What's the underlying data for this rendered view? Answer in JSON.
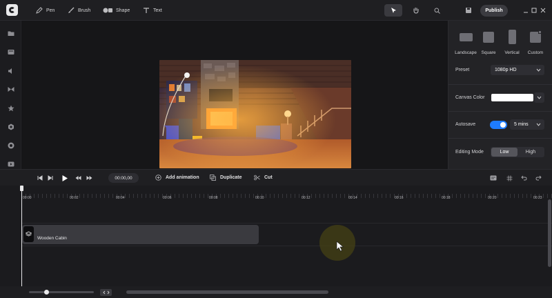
{
  "toolbar": {
    "tools": [
      {
        "label": "Pen",
        "icon": "pen-icon"
      },
      {
        "label": "Brush",
        "icon": "brush-icon"
      },
      {
        "label": "Shape",
        "icon": "shape-icon"
      },
      {
        "label": "Text",
        "icon": "text-icon"
      }
    ],
    "modes": [
      "select-arrow-icon",
      "hand-icon",
      "zoom-icon"
    ],
    "active_mode": "select-arrow-icon",
    "publish_label": "Publish"
  },
  "rail": [
    "folder-icon",
    "media-icon",
    "audio-icon",
    "transition-icon",
    "star-icon",
    "settings-icon",
    "record-icon",
    "video-icon"
  ],
  "panel": {
    "formats": [
      {
        "label": "Landscape"
      },
      {
        "label": "Square"
      },
      {
        "label": "Vertical"
      },
      {
        "label": "Custom"
      }
    ],
    "preset_label": "Preset",
    "preset_value": "1080p HD",
    "canvas_color_label": "Canvas Color",
    "canvas_color": "#ffffff",
    "autosave_label": "Autosave",
    "autosave_on": true,
    "autosave_value": "5 mins",
    "editing_mode_label": "Editing Mode",
    "editing_modes": [
      "Low",
      "High"
    ],
    "editing_mode_active": "Low"
  },
  "controls": {
    "timecode": "00:00,00",
    "add_animation": "Add animation",
    "duplicate": "Duplicate",
    "cut": "Cut"
  },
  "timeline": {
    "ticks": [
      "00:00",
      "00:02",
      "00:04",
      "00:06",
      "00:08",
      "00:10",
      "00:12",
      "00:14",
      "00:16",
      "00:18",
      "00:20",
      "00:23"
    ],
    "clip_label": "Wooden Cabin"
  },
  "colors": {
    "accent": "#1e7cff",
    "background": "#18181a"
  }
}
